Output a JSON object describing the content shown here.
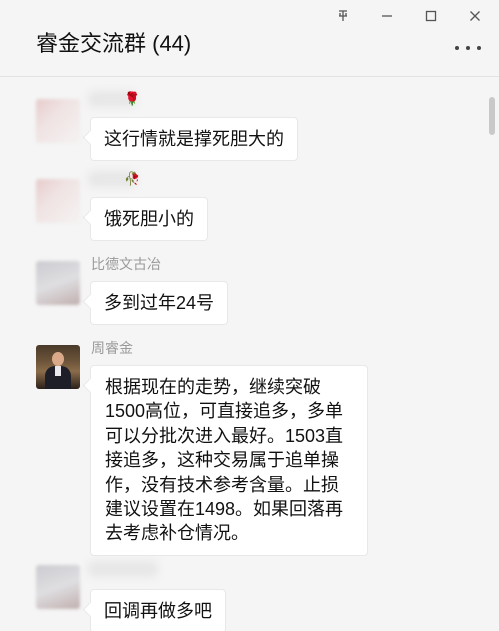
{
  "window": {
    "title": "睿金交流群 (44)",
    "controls": {
      "pin_icon": "pin-icon",
      "minimize_icon": "minimize-icon",
      "maximize_icon": "maximize-icon",
      "close_icon": "close-icon"
    },
    "more_icon": "more-icon"
  },
  "messages": [
    {
      "sender": "",
      "text": "这行情就是撑死胆大的"
    },
    {
      "sender": "",
      "text": "饿死胆小的"
    },
    {
      "sender": "比德文古冶",
      "text": "多到过年24号"
    },
    {
      "sender": "周睿金",
      "text": "根据现在的走势，继续突破1500高位，可直接追多，多单可以分批次进入最好。1503直接追多，这种交易属于追单操作，没有技术参考含量。止损建议设置在1498。如果回落再去考虑补仓情况。"
    },
    {
      "sender": "",
      "text": "回调再做多吧"
    }
  ],
  "colors": {
    "background": "#f5f5f5",
    "bubble": "#ffffff",
    "sender_name": "#9a9a9a",
    "rose": "#c0392b"
  }
}
